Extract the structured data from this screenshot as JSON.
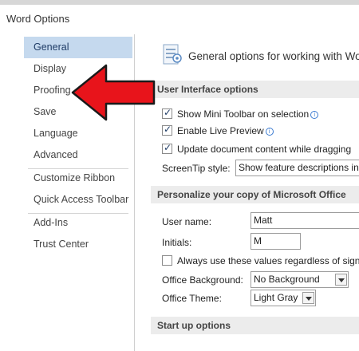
{
  "window": {
    "title": "Word Options"
  },
  "sidebar": {
    "items": [
      {
        "label": "General"
      },
      {
        "label": "Display"
      },
      {
        "label": "Proofing"
      },
      {
        "label": "Save"
      },
      {
        "label": "Language"
      },
      {
        "label": "Advanced"
      },
      {
        "label": "Customize Ribbon"
      },
      {
        "label": "Quick Access Toolbar"
      },
      {
        "label": "Add-Ins"
      },
      {
        "label": "Trust Center"
      }
    ],
    "selected": "General"
  },
  "main": {
    "header": {
      "text": "General options for working with Wo",
      "icon": "general-options-icon"
    },
    "ui_options": {
      "title": "User Interface options",
      "mini_toolbar": {
        "label": "Show Mini Toolbar on selection",
        "checked": true
      },
      "live_preview": {
        "label": "Enable Live Preview",
        "checked": true
      },
      "update_drag": {
        "label": "Update document content while dragging",
        "checked": true
      },
      "screentip": {
        "label": "ScreenTip style:",
        "value": "Show feature descriptions in"
      }
    },
    "personalize": {
      "title": "Personalize your copy of Microsoft Office",
      "user_name": {
        "label": "User name:",
        "value": "Matt"
      },
      "initials": {
        "label": "Initials:",
        "value": "M"
      },
      "always_use": {
        "label": "Always use these values regardless of sign i",
        "checked": false
      },
      "background": {
        "label": "Office Background:",
        "value": "No Background"
      },
      "theme": {
        "label": "Office Theme:",
        "value": "Light Gray"
      }
    },
    "startup": {
      "title": "Start up options"
    }
  },
  "annotation": {
    "color": "#e8141b"
  },
  "colors": {
    "selected_bg": "#c5d9ee",
    "section_bg": "#ececec"
  }
}
